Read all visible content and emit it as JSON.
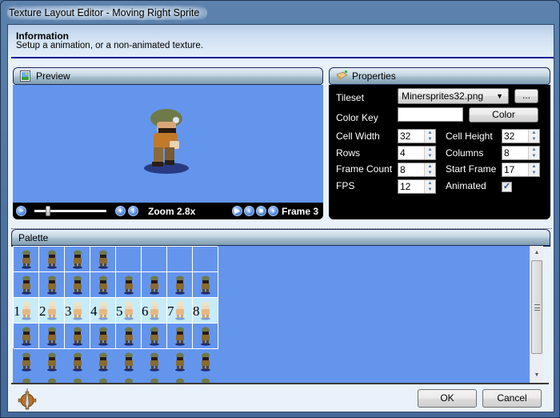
{
  "window": {
    "title": "Texture Layout Editor - Moving Right Sprite"
  },
  "info": {
    "title": "Information",
    "subtitle": "Setup a animation, or a non-animated texture."
  },
  "preview": {
    "header": "Preview",
    "header_icon": "image-icon",
    "zoom_label": "Zoom 2.8x",
    "zoom_value": 2.8,
    "frame_label": "Frame 3",
    "controls": {
      "zoom_out_icon": "zoom-out-icon",
      "zoom_in_icon": "zoom-in-icon",
      "zoom_reset_icon": "zoom-fit-icon",
      "play_icon": "play-icon",
      "prev_icon": "previous-frame-icon",
      "stop_icon": "stop-icon",
      "next_icon": "next-frame-icon"
    }
  },
  "properties": {
    "header": "Properties",
    "header_icon": "properties-icon",
    "tileset_label": "Tileset",
    "tileset_value": "Minersprites32.png",
    "browse_label": "...",
    "color_key_label": "Color Key",
    "color_key_value": "",
    "color_button": "Color",
    "cell_width_label": "Cell Width",
    "cell_width": "32",
    "cell_height_label": "Cell Height",
    "cell_height": "32",
    "rows_label": "Rows",
    "rows": "4",
    "columns_label": "Columns",
    "columns": "8",
    "frame_count_label": "Frame Count",
    "frame_count": "8",
    "start_frame_label": "Start Frame",
    "start_frame": "17",
    "fps_label": "FPS",
    "fps": "12",
    "animated_label": "Animated",
    "animated": true,
    "check_glyph": "✓"
  },
  "palette": {
    "header": "Palette",
    "selected_row": 2,
    "frame_numbers": [
      "1",
      "2",
      "3",
      "4",
      "5",
      "6",
      "7",
      "8"
    ]
  },
  "buttons": {
    "ok": "OK",
    "cancel": "Cancel"
  },
  "scrollbar": {
    "up": "▲",
    "down": "▼"
  }
}
